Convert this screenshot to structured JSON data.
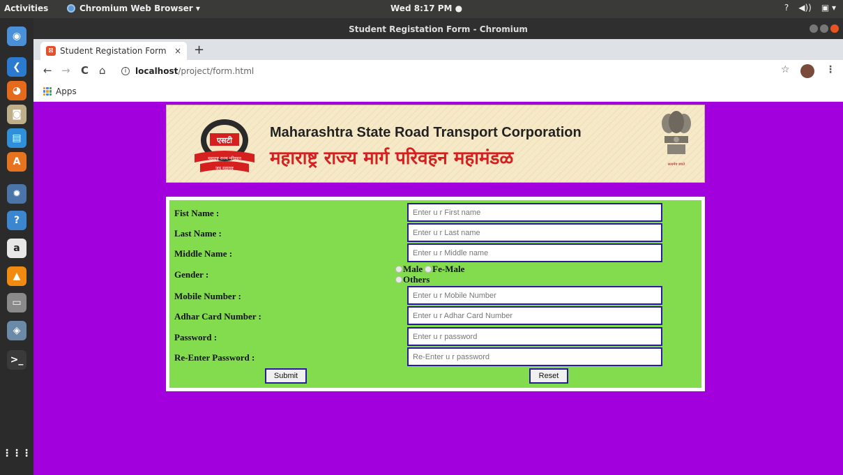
{
  "topbar": {
    "activities": "Activities",
    "app_name": "Chromium Web Browser ▾",
    "clock": "Wed  8:17 PM ●",
    "tray": [
      "?",
      "◀))",
      "▣ ▾"
    ]
  },
  "dock": {
    "icons": [
      {
        "name": "chromium-icon",
        "glyph": "◉",
        "color": "#4a90d9"
      },
      {
        "name": "vscode-icon",
        "glyph": "❮",
        "color": "#2a7ad0"
      },
      {
        "name": "firefox-icon",
        "glyph": "◕",
        "color": "#e66a1c"
      },
      {
        "name": "camera-icon",
        "glyph": "◙",
        "color": "#bfae8a"
      },
      {
        "name": "document-icon",
        "glyph": "▤",
        "color": "#2f8fd8"
      },
      {
        "name": "software-center-icon",
        "glyph": "A",
        "color": "#e6731f"
      },
      {
        "name": "settings-icon",
        "glyph": "✹",
        "color": "#4b74a8"
      },
      {
        "name": "help-icon",
        "glyph": "?",
        "color": "#3b86cf"
      },
      {
        "name": "amazon-icon",
        "glyph": "a",
        "color": "#e8e8e8"
      },
      {
        "name": "vlc-icon",
        "glyph": "▲",
        "color": "#f08a10"
      },
      {
        "name": "files-icon",
        "glyph": "▭",
        "color": "#8a8a8a"
      },
      {
        "name": "screenshot-icon",
        "glyph": "◈",
        "color": "#6a8aa8"
      },
      {
        "name": "terminal-icon",
        "glyph": ">_",
        "color": "#3a3a3a"
      },
      {
        "name": "show-apps-icon",
        "glyph": "⋮⋮⋮",
        "color": "#2b2b2b"
      }
    ]
  },
  "window": {
    "title": "Student Registation Form - Chromium"
  },
  "browser": {
    "tab_title": "Student Registation Form",
    "tab_close": "×",
    "new_tab": "+",
    "back": "←",
    "forward": "→",
    "reload": "C",
    "home": "⌂",
    "url_host": "localhost",
    "url_path": "/project/form.html",
    "star": "☆",
    "menu": "⋮",
    "bookmark_apps": "Apps"
  },
  "banner": {
    "en_title": "Maharashtra State Road Transport Corporation",
    "mr_title": "महाराष्ट्र राज्य मार्ग परिवहन महामंडळ",
    "logo_text_top": "एसटी",
    "logo_text_band": "महाराष्ट्र राज्य परिवहन",
    "logo_text_bottom": "जय महाराष्ट्र",
    "emblem_caption": "सत्यमेव जयते"
  },
  "form": {
    "first_name_label": "Fist Name :",
    "first_name_placeholder": "Enter u r First name",
    "last_name_label": "Last Name :",
    "last_name_placeholder": "Enter u r Last name",
    "middle_name_label": "Middle Name :",
    "middle_name_placeholder": "Enter u r Middle name",
    "gender_label": "Gender :",
    "gender_options": [
      "Male",
      "Fe-Male",
      "Others"
    ],
    "mobile_label": "Mobile Number :",
    "mobile_placeholder": "Enter u r Mobile Number",
    "adhar_label": "Adhar Card Number :",
    "adhar_placeholder": "Enter u r Adhar Card Number",
    "password_label": "Password :",
    "password_placeholder": "Enter u r password",
    "reenter_label": "Re-Enter Password :",
    "reenter_placeholder": "Re-Enter u r password",
    "submit_label": "Submit",
    "reset_label": "Reset"
  },
  "colors": {
    "page_background": "#a200dc",
    "form_background": "#83dc4e",
    "input_border": "#2a1aa0",
    "banner_red": "#d62020"
  }
}
